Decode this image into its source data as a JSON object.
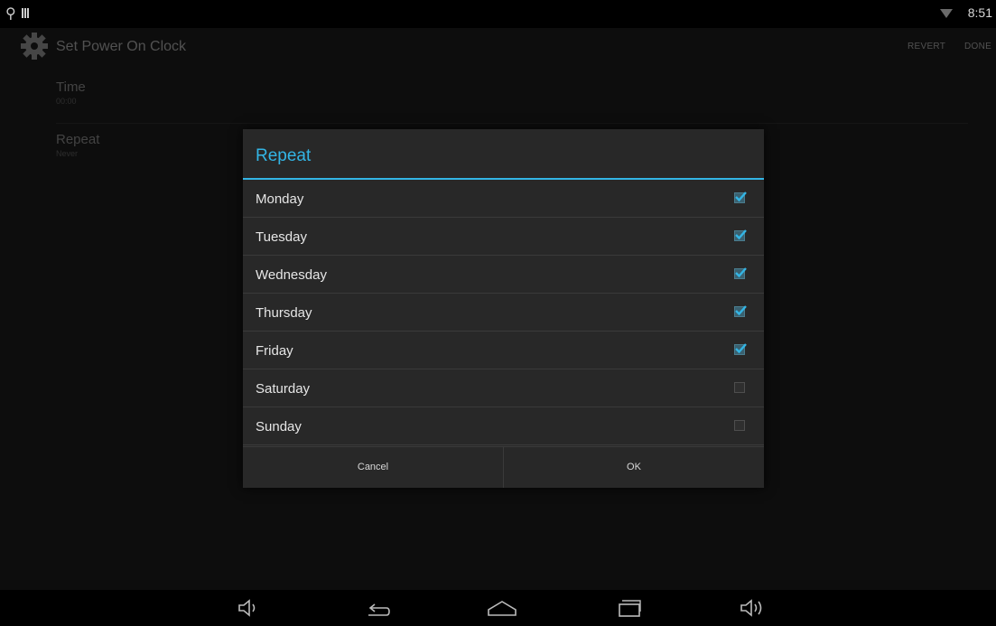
{
  "status_bar": {
    "time": "8:51",
    "icons": [
      "usb-icon",
      "sd-card-icon",
      "wifi-icon"
    ]
  },
  "action_bar": {
    "app_icon": "settings-gear-icon",
    "title": "Set Power On Clock",
    "revert_label": "REVERT",
    "done_label": "DONE"
  },
  "preferences": [
    {
      "title": "Time",
      "summary": "00:00"
    },
    {
      "title": "Repeat",
      "summary": "Never"
    }
  ],
  "dialog": {
    "title": "Repeat",
    "accent_color": "#33b5e5",
    "days": [
      {
        "label": "Monday",
        "checked": true
      },
      {
        "label": "Tuesday",
        "checked": true
      },
      {
        "label": "Wednesday",
        "checked": true
      },
      {
        "label": "Thursday",
        "checked": true
      },
      {
        "label": "Friday",
        "checked": true
      },
      {
        "label": "Saturday",
        "checked": false
      },
      {
        "label": "Sunday",
        "checked": false
      }
    ],
    "cancel_label": "Cancel",
    "ok_label": "OK"
  },
  "nav_bar": {
    "icons": [
      "volume-down-icon",
      "back-icon",
      "home-icon",
      "recent-apps-icon",
      "volume-up-icon"
    ]
  }
}
